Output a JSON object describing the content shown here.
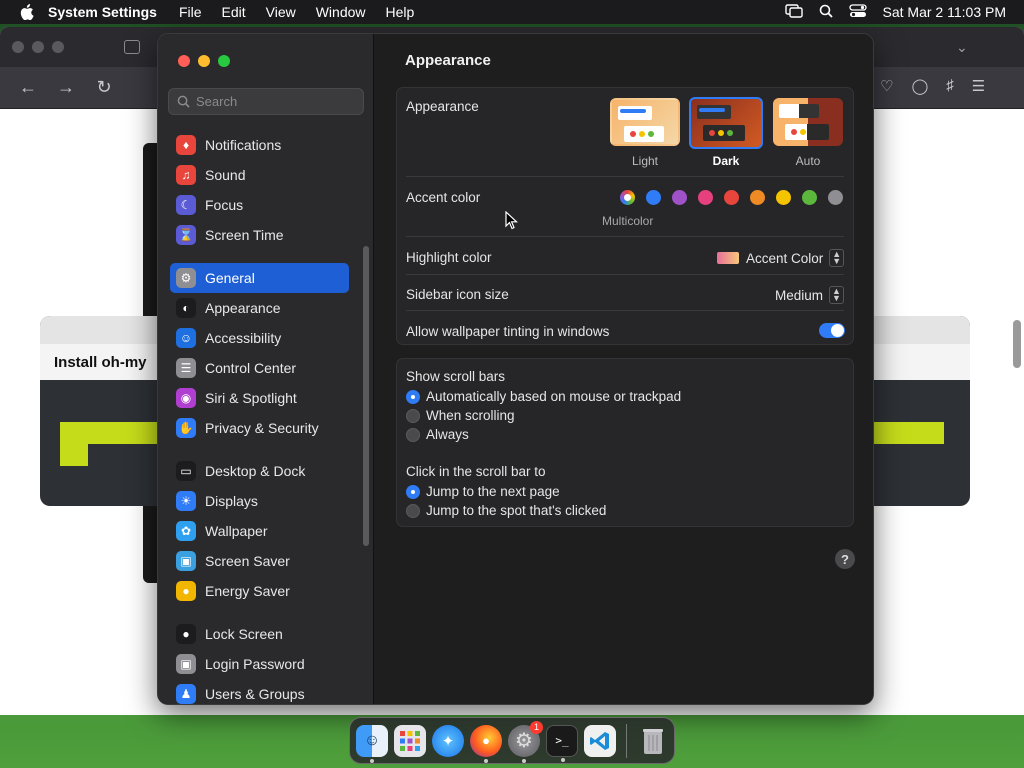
{
  "menubar": {
    "app_name": "System Settings",
    "menus": [
      "File",
      "Edit",
      "View",
      "Window",
      "Help"
    ],
    "clock": "Sat Mar 2  11:03 PM"
  },
  "browser_page": {
    "card_title": "Install oh-my"
  },
  "search": {
    "placeholder": "Search"
  },
  "sidebar": {
    "items": [
      {
        "label": "Notifications",
        "icon": "bell-icon",
        "color": "#e8453c"
      },
      {
        "label": "Sound",
        "icon": "speaker-icon",
        "color": "#e8453c"
      },
      {
        "label": "Focus",
        "icon": "moon-icon",
        "color": "#5b5bd6"
      },
      {
        "label": "Screen Time",
        "icon": "hourglass-icon",
        "color": "#5b5bd6"
      },
      {
        "label": "General",
        "icon": "gear-icon",
        "color": "#8e8e93",
        "selected": true
      },
      {
        "label": "Appearance",
        "icon": "appearance-icon",
        "color": "#1c1c1e"
      },
      {
        "label": "Accessibility",
        "icon": "accessibility-icon",
        "color": "#1e6fe0"
      },
      {
        "label": "Control Center",
        "icon": "control-center-icon",
        "color": "#8e8e93"
      },
      {
        "label": "Siri & Spotlight",
        "icon": "siri-icon",
        "color": "#b03fd1"
      },
      {
        "label": "Privacy & Security",
        "icon": "hand-icon",
        "color": "#2f7cf6"
      },
      {
        "label": "Desktop & Dock",
        "icon": "dock-icon",
        "color": "#1c1c1e"
      },
      {
        "label": "Displays",
        "icon": "sun-icon",
        "color": "#2f7cf6"
      },
      {
        "label": "Wallpaper",
        "icon": "flower-icon",
        "color": "#2fa0f0"
      },
      {
        "label": "Screen Saver",
        "icon": "screen-saver-icon",
        "color": "#3aa0e0"
      },
      {
        "label": "Energy Saver",
        "icon": "bulb-icon",
        "color": "#f2b600"
      },
      {
        "label": "Lock Screen",
        "icon": "lock-icon",
        "color": "#1c1c1e"
      },
      {
        "label": "Login Password",
        "icon": "padlock-icon",
        "color": "#8e8e93"
      },
      {
        "label": "Users & Groups",
        "icon": "users-icon",
        "color": "#2f7cf6"
      }
    ]
  },
  "content": {
    "title": "Appearance",
    "appearance": {
      "label": "Appearance",
      "options": [
        "Light",
        "Dark",
        "Auto"
      ],
      "selected": "Dark"
    },
    "accent": {
      "label": "Accent color",
      "caption": "Multicolor",
      "colors": [
        "#2f7cf6",
        "#9f52c8",
        "#e6407f",
        "#e8453c",
        "#f08a24",
        "#f5c400",
        "#5cb83c",
        "#8e8e93"
      ]
    },
    "highlight": {
      "label": "Highlight color",
      "value": "Accent Color"
    },
    "icon_size": {
      "label": "Sidebar icon size",
      "value": "Medium"
    },
    "tinting": {
      "label": "Allow wallpaper tinting in windows",
      "on": true
    },
    "scroll_bars": {
      "label": "Show scroll bars",
      "options": [
        "Automatically based on mouse or trackpad",
        "When scrolling",
        "Always"
      ],
      "selected": 0
    },
    "click_scroll": {
      "label": "Click in the scroll bar to",
      "options": [
        "Jump to the next page",
        "Jump to the spot that's clicked"
      ],
      "selected": 0
    },
    "help": "?"
  },
  "dock": {
    "apps": [
      "Finder",
      "Launchpad",
      "Safari",
      "Firefox",
      "System Settings",
      "Terminal",
      "Visual Studio Code",
      "Trash"
    ],
    "badge": "1"
  }
}
